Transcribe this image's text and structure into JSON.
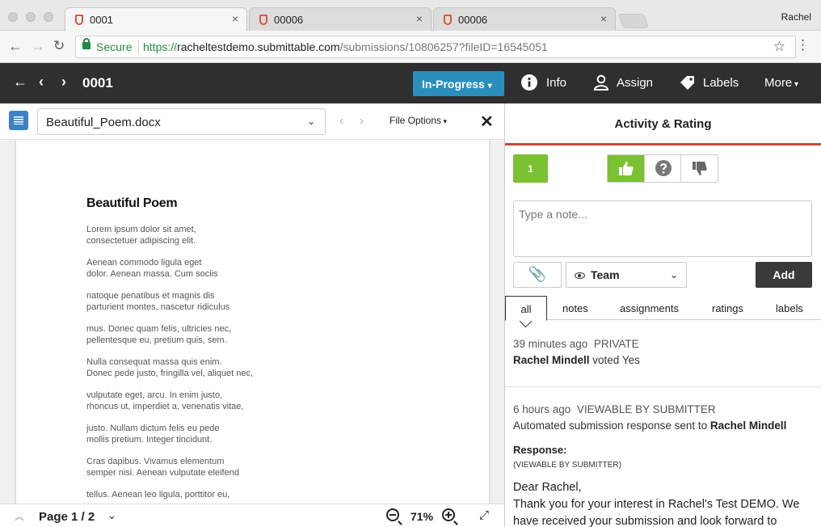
{
  "browser": {
    "tabs": [
      {
        "title": "0001",
        "close": "×",
        "active": true
      },
      {
        "title": "00006",
        "close": "×",
        "active": false
      },
      {
        "title": "00006",
        "close": "×",
        "active": false
      }
    ],
    "profile": "Rachel",
    "secure_label": "Secure",
    "url_scheme": "https://",
    "url_host": "racheltestdemo.submittable.com",
    "url_path": "/submissions/10806257?fileID=16545051"
  },
  "header": {
    "submission_number": "0001",
    "status": "In-Progress",
    "info_label": "Info",
    "assign_label": "Assign",
    "labels_label": "Labels",
    "more_label": "More"
  },
  "viewer": {
    "file_name": "Beautiful_Poem.docx",
    "file_options_label": "File Options",
    "page_label": "Page 1 / 2",
    "zoom": "71%",
    "document": {
      "title": "Beautiful Poem",
      "stanzas": [
        [
          "Lorem ipsum dolor sit amet,",
          "consectetuer adipiscing elit."
        ],
        [
          "Aenean commodo ligula eget",
          "dolor. Aenean massa. Cum sociis"
        ],
        [
          "natoque penatibus et magnis dis",
          "parturient montes, nascetur ridiculus"
        ],
        [
          "mus. Donec quam felis, ultricies nec,",
          "pellentesque eu, pretium quis, sem."
        ],
        [
          "Nulla consequat massa quis enim.",
          "Donec pede justo, fringilla vel, aliquet nec,"
        ],
        [
          "vulputate eget, arcu. In enim justo,",
          "rhoncus ut, imperdiet a, venenatis vitae,"
        ],
        [
          "justo. Nullam dictum felis eu pede",
          "mollis pretium. Integer tincidunt."
        ],
        [
          "Cras dapibus. Vivamus elementum",
          "semper nisi. Aenean vulputate eleifend"
        ],
        [
          "tellus. Aenean leo ligula, porttitor eu,",
          ""
        ]
      ]
    }
  },
  "panel": {
    "title": "Activity & Rating",
    "score": "1",
    "note_placeholder": "Type a note...",
    "visibility": "Team",
    "add_label": "Add",
    "filters": [
      "all",
      "notes",
      "assignments",
      "ratings",
      "labels"
    ],
    "activity": [
      {
        "time": "39 minutes ago",
        "visibility": "PRIVATE",
        "actor": "Rachel Mindell",
        "text": " voted Yes"
      },
      {
        "time": "6 hours ago",
        "visibility": "VIEWABLE BY SUBMITTER",
        "text": "Automated submission response sent to ",
        "target": "Rachel Mindell",
        "response_label": "Response:",
        "response_visibility": "(VIEWABLE BY SUBMITTER)",
        "greeting": "Dear Rachel,",
        "message": "Thank you for your interest in Rachel's Test DEMO. We have received your submission and look forward to"
      }
    ]
  },
  "colors": {
    "accent": "#2a8fbd",
    "rating_green": "#7ac231",
    "header_bg": "#2f2f2f",
    "divider_red": "#c9473a"
  }
}
